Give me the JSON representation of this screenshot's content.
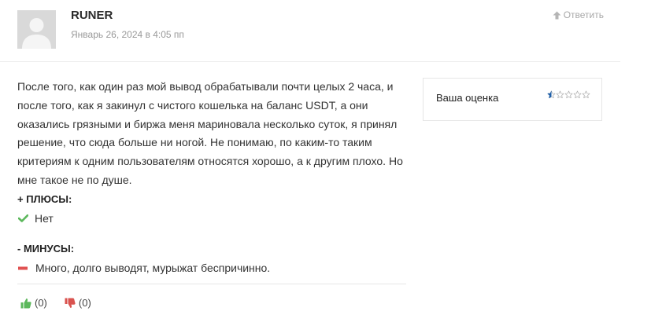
{
  "comment": {
    "author": "RUNER",
    "date": "Январь 26, 2024 в 4:05 пп",
    "reply_label": "Ответить",
    "reply_icon": "up-arrow-icon",
    "text": "После того, как один раз мой вывод обрабатывали почти целых 2 часа, и после того, как я закинул с чистого кошелька на баланс USDT, а они оказались грязными и биржа меня мариновала несколько суток, я принял решение, что сюда больше ни ногой. Не понимаю, по каким-то таким критериям к одним пользователям относятся хорошо, а к другим плохо. Но мне такое не по душе.",
    "pros": {
      "title": "+ ПЛЮСЫ:",
      "items": [
        "Нет"
      ],
      "icon": "check-icon",
      "icon_color": "#5cb85c"
    },
    "cons": {
      "title": "- МИНУСЫ:",
      "items": [
        "Много, долго выводят, мурыжат беспричинно."
      ],
      "icon": "minus-icon",
      "icon_color": "#e05252"
    },
    "votes": {
      "like_count": "(0)",
      "dislike_count": "(0)",
      "like_color": "#5cb85c",
      "dislike_color": "#d9534f"
    }
  },
  "rating": {
    "label": "Ваша оценка",
    "max": 5,
    "value": 0.5,
    "color": "#1f5fa8"
  }
}
